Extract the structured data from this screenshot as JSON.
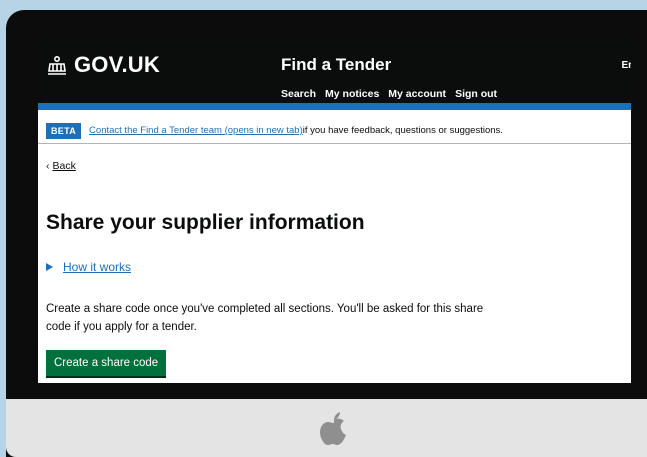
{
  "header": {
    "logo_text": "GOV.UK",
    "service_name": "Find a Tender",
    "nav": [
      "Search",
      "My notices",
      "My account",
      "Sign out"
    ],
    "lang_partial": "Er"
  },
  "beta_banner": {
    "tag": "BETA",
    "link": "Contact the Find a Tender team (opens in new tab)",
    "text": " if you have feedback, questions or suggestions."
  },
  "back_link": {
    "chevron": "‹",
    "label": "Back"
  },
  "page_title": "Share your supplier information",
  "details": {
    "label": "How it works"
  },
  "body_text": "Create a share code once you've completed all sections. You'll be asked for this share code if you apply for a tender.",
  "cta_button": "Create a share code",
  "colors": {
    "header_bg": "#0b0c0c",
    "accent_blue": "#1d70b8",
    "button_green": "#00703c",
    "page_bg": "#b7d3e6"
  },
  "icons": [
    "crown-icon",
    "apple-logo"
  ]
}
